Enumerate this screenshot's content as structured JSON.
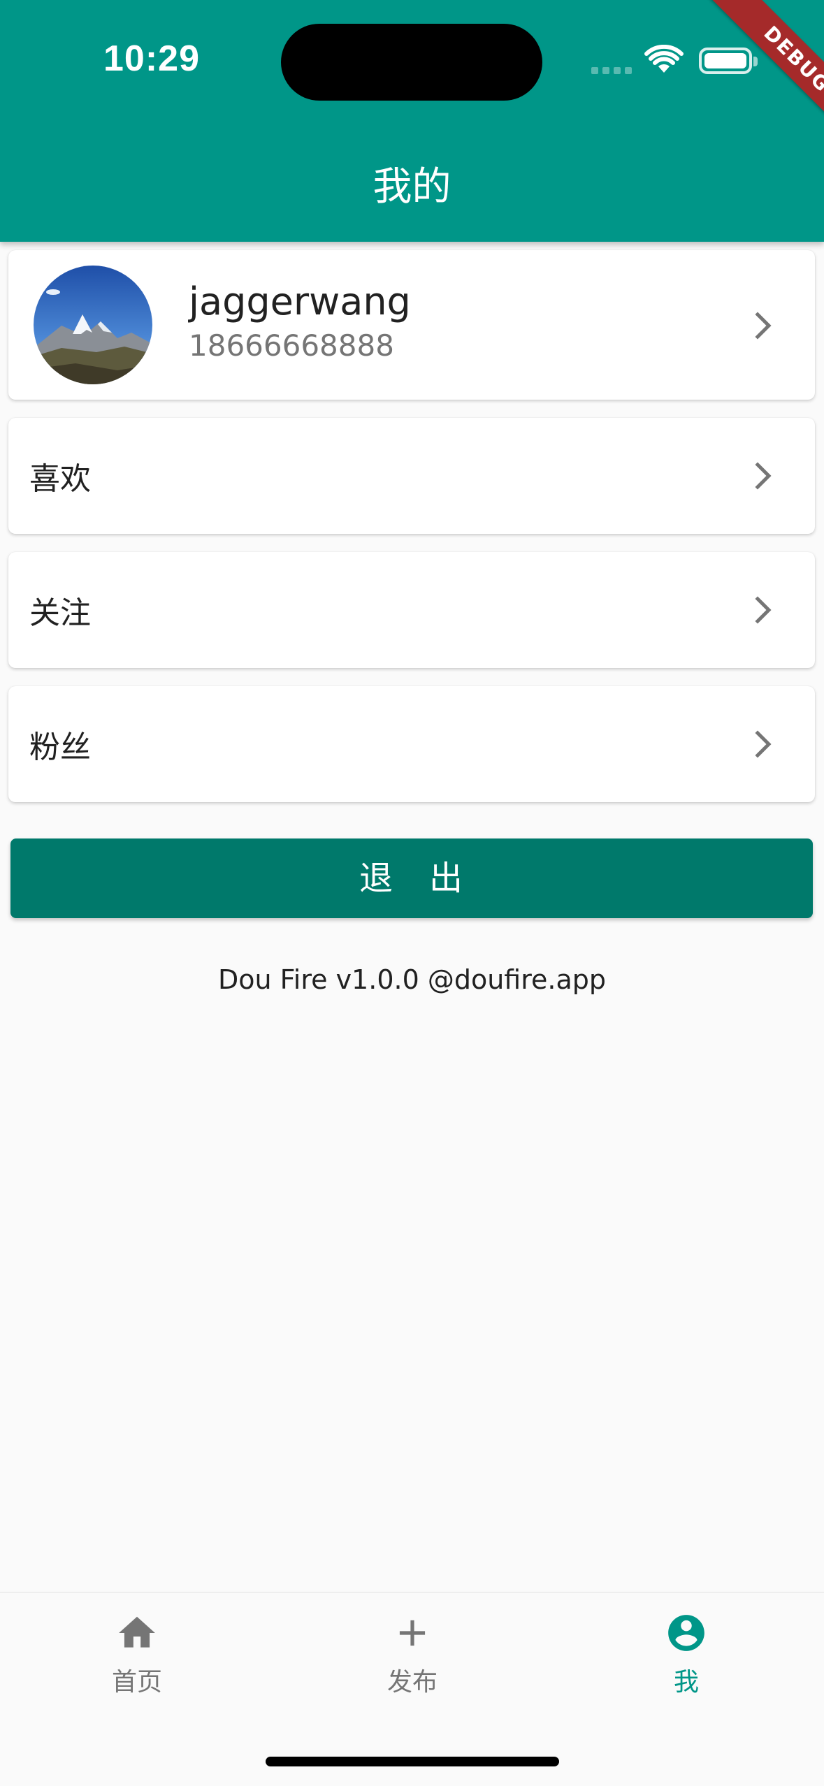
{
  "status_bar": {
    "time": "10:29",
    "debug_banner": "DEBUG"
  },
  "app_bar": {
    "title": "我的"
  },
  "profile": {
    "username": "jaggerwang",
    "phone": "18666668888",
    "avatar_icon": "mountain-avatar-photo"
  },
  "menu": [
    {
      "label": "喜欢"
    },
    {
      "label": "关注"
    },
    {
      "label": "粉丝"
    }
  ],
  "logout_label": "退　出",
  "footer": {
    "version": "Dou Fire v1.0.0 @doufire.app"
  },
  "bottom_nav": {
    "items": [
      {
        "label": "首页",
        "icon": "home-icon",
        "active": false
      },
      {
        "label": "发布",
        "icon": "add-icon",
        "active": false
      },
      {
        "label": "我",
        "icon": "account-circle-icon",
        "active": true
      }
    ]
  },
  "colors": {
    "primary": "#009688",
    "button": "#00796b",
    "background": "#fafafa",
    "debug": "#a52a2a"
  }
}
